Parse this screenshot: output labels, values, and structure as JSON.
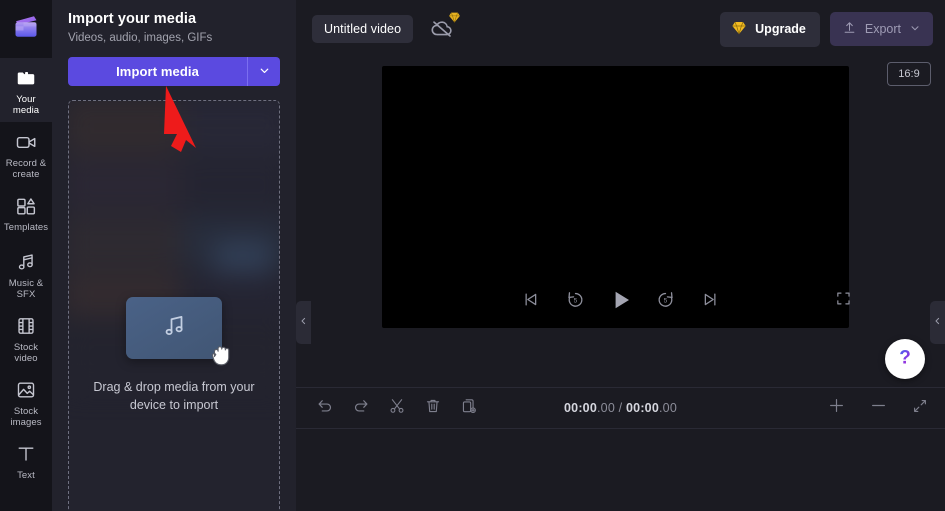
{
  "app": {
    "logo_icon": "clipchamp-logo-icon",
    "accent": "#5b4ae0",
    "panel_bg": "#22222c",
    "rail_bg": "#14141a"
  },
  "sidebar": {
    "items": [
      {
        "label": "Your media",
        "icon": "folder-icon",
        "active": true
      },
      {
        "label": "Record &\ncreate",
        "icon": "video-camera-icon",
        "active": false
      },
      {
        "label": "Templates",
        "icon": "templates-icon",
        "active": false
      },
      {
        "label": "Music & SFX",
        "icon": "music-note-icon",
        "active": false
      },
      {
        "label": "Stock video",
        "icon": "film-strip-icon",
        "active": false
      },
      {
        "label": "Stock\nimages",
        "icon": "image-icon",
        "active": false
      },
      {
        "label": "Text",
        "icon": "text-icon",
        "active": false
      }
    ]
  },
  "media_panel": {
    "title": "Import your media",
    "subtitle": "Videos, audio, images, GIFs",
    "import_button": "Import media",
    "import_caret_icon": "chevron-down-icon",
    "dropzone_text": "Drag & drop media from your device to import",
    "drag_card_icon": "music-note-icon",
    "cursor_icon": "grabbing-hand-cursor"
  },
  "topbar": {
    "project_title": "Untitled video",
    "cloud_icon": "cloud-offline-icon",
    "cloud_badge_icon": "premium-diamond-icon",
    "upgrade_label": "Upgrade",
    "upgrade_icon": "premium-diamond-icon",
    "export_label": "Export",
    "export_icon": "upload-arrow-icon",
    "export_caret_icon": "chevron-down-icon"
  },
  "preview": {
    "aspect_ratio": "16:9",
    "fullscreen_icon": "fullscreen-icon",
    "controls": [
      {
        "name": "skip-to-start-button",
        "icon": "skip-previous-icon"
      },
      {
        "name": "rewind-5s-button",
        "icon": "rewind-5-icon"
      },
      {
        "name": "play-button",
        "icon": "play-icon"
      },
      {
        "name": "forward-5s-button",
        "icon": "forward-5-icon"
      },
      {
        "name": "skip-to-end-button",
        "icon": "skip-next-icon"
      }
    ]
  },
  "help": {
    "icon": "question-mark-icon"
  },
  "collapse": {
    "left_icon": "chevron-left-icon",
    "right_icon": "chevron-left-icon"
  },
  "timeline": {
    "tools": [
      {
        "name": "undo-button",
        "icon": "undo-icon"
      },
      {
        "name": "redo-button",
        "icon": "redo-icon"
      },
      {
        "name": "split-button",
        "icon": "scissors-icon"
      },
      {
        "name": "delete-button",
        "icon": "trash-icon"
      },
      {
        "name": "duplicate-button",
        "icon": "duplicate-icon"
      }
    ],
    "current_time": "00:00",
    "current_frames": ".00",
    "separator": " / ",
    "total_time": "00:00",
    "total_frames": ".00",
    "zoom_in_icon": "plus-icon",
    "zoom_out_icon": "minus-icon",
    "fit_icon": "fit-to-screen-icon"
  },
  "annotation": {
    "arrow_color": "#ee1b1b",
    "points_to": "Import media"
  }
}
